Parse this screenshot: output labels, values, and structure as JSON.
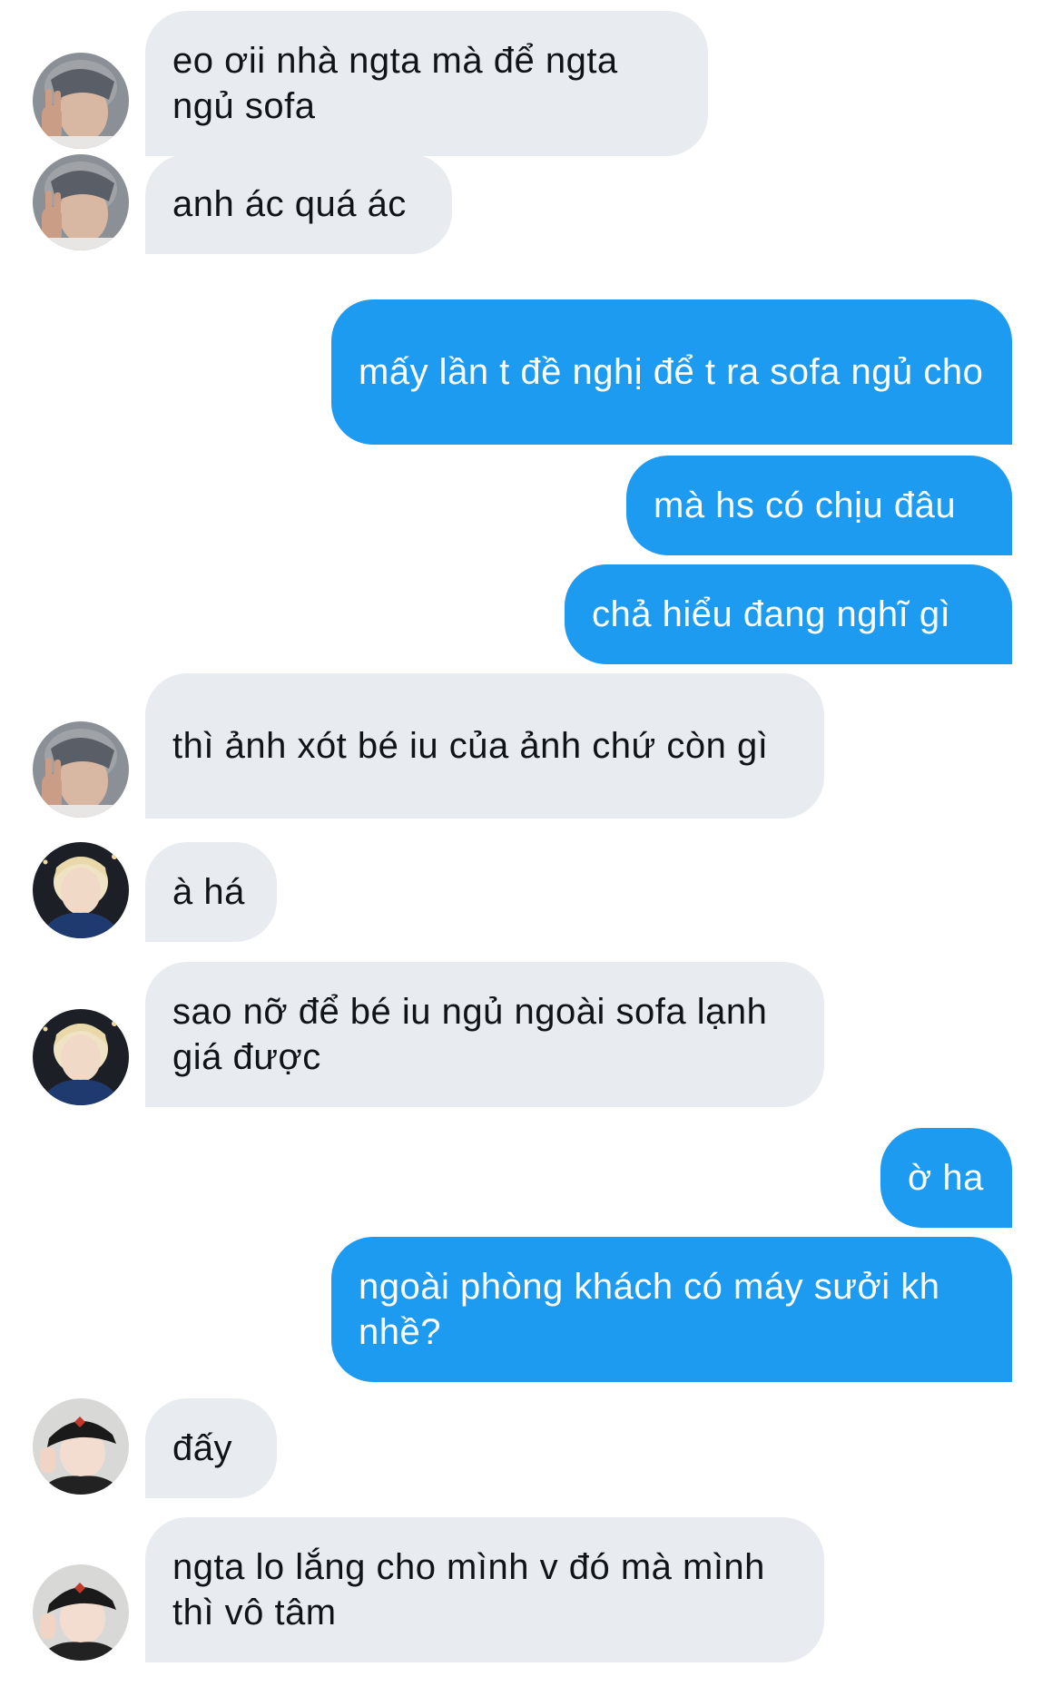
{
  "conversation": {
    "messages": [
      {
        "side": "in",
        "text": "eo ơii nhà ngta mà để ngta ngủ sofa",
        "avatar": "a"
      },
      {
        "side": "in",
        "text": "anh ác quá ác",
        "avatar": "a"
      },
      {
        "side": "out",
        "text": "mấy lần t đề nghị để t ra sofa ngủ cho"
      },
      {
        "side": "out",
        "text": "mà hs có chịu đâu"
      },
      {
        "side": "out",
        "text": "chả hiểu đang nghĩ gì"
      },
      {
        "side": "in",
        "text": "thì ảnh xót bé iu của ảnh chứ còn gì",
        "avatar": "a"
      },
      {
        "side": "in",
        "text": "à há",
        "avatar": "b"
      },
      {
        "side": "in",
        "text": "sao nỡ để bé iu ngủ ngoài sofa lạnh giá được",
        "avatar": "b"
      },
      {
        "side": "out",
        "text": "ờ ha"
      },
      {
        "side": "out",
        "text": "ngoài phòng khách có máy sưởi kh nhề?"
      },
      {
        "side": "in",
        "text": "đấy",
        "avatar": "c"
      },
      {
        "side": "in",
        "text": "ngta lo lắng cho mình v đó mà mình thì vô tâm",
        "avatar": "c"
      }
    ]
  },
  "colors": {
    "incoming_bubble": "#e8ecf0",
    "outgoing_bubble": "#1d9bf0",
    "incoming_text": "#0f1419",
    "outgoing_text": "#ffffff"
  },
  "icons": {
    "avatar_a": "avatar-dark-hair-peace-sign-icon",
    "avatar_b": "avatar-blonde-hair-icon",
    "avatar_c": "avatar-black-cap-icon"
  }
}
